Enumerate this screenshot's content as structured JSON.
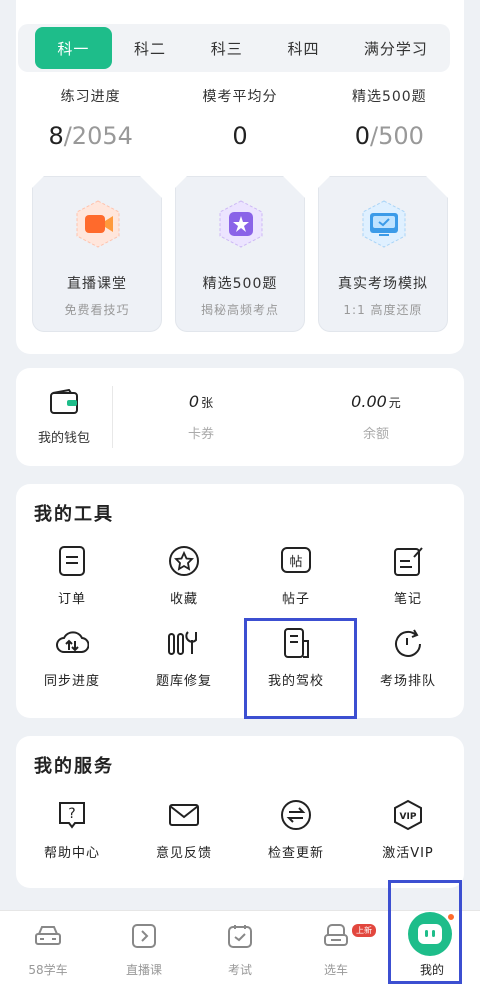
{
  "tabs": [
    {
      "label": "科一",
      "active": true
    },
    {
      "label": "科二"
    },
    {
      "label": "科三"
    },
    {
      "label": "科四"
    },
    {
      "label": "满分学习"
    }
  ],
  "stats": {
    "progress": {
      "label": "练习进度",
      "value": "8",
      "total": "/2054"
    },
    "mock_avg": {
      "label": "模考平均分",
      "value": "0"
    },
    "selected": {
      "label": "精选500题",
      "value": "0",
      "total": "/500"
    }
  },
  "tiles": [
    {
      "title": "直播课堂",
      "subtitle": "免费看技巧",
      "icon": "video-camera-icon",
      "color": "#ff6a2c"
    },
    {
      "title": "精选500题",
      "subtitle": "揭秘高频考点",
      "icon": "star-book-icon",
      "color": "#8a63e8"
    },
    {
      "title": "真实考场模拟",
      "subtitle": "1:1 高度还原",
      "icon": "monitor-check-icon",
      "color": "#3c9be8"
    }
  ],
  "wallet": {
    "label": "我的钱包",
    "coupons": {
      "value": "0",
      "unit": "张",
      "label": "卡券"
    },
    "balance": {
      "value": "0.00",
      "unit": "元",
      "label": "余额"
    }
  },
  "tools": {
    "title": "我的工具",
    "items": [
      {
        "label": "订单",
        "icon": "order-icon"
      },
      {
        "label": "收藏",
        "icon": "star-icon"
      },
      {
        "label": "帖子",
        "icon": "post-icon"
      },
      {
        "label": "笔记",
        "icon": "note-icon"
      },
      {
        "label": "同步进度",
        "icon": "cloud-sync-icon"
      },
      {
        "label": "题库修复",
        "icon": "repair-icon"
      },
      {
        "label": "我的驾校",
        "icon": "school-icon"
      },
      {
        "label": "考场排队",
        "icon": "queue-timer-icon"
      }
    ]
  },
  "services": {
    "title": "我的服务",
    "items": [
      {
        "label": "帮助中心",
        "icon": "help-icon"
      },
      {
        "label": "意见反馈",
        "icon": "mail-icon"
      },
      {
        "label": "检查更新",
        "icon": "update-icon"
      },
      {
        "label": "激活VIP",
        "icon": "vip-icon"
      }
    ]
  },
  "nav": {
    "items": [
      {
        "label": "58学车",
        "icon": "car-icon"
      },
      {
        "label": "直播课",
        "icon": "play-icon"
      },
      {
        "label": "考试",
        "icon": "exam-icon"
      },
      {
        "label": "选车",
        "icon": "seat-icon"
      },
      {
        "label": "我的",
        "icon": "profile-icon",
        "active": true
      }
    ],
    "badge": "上新"
  },
  "colors": {
    "accent": "#1ebd8a",
    "highlight": "#3c4fd1"
  }
}
